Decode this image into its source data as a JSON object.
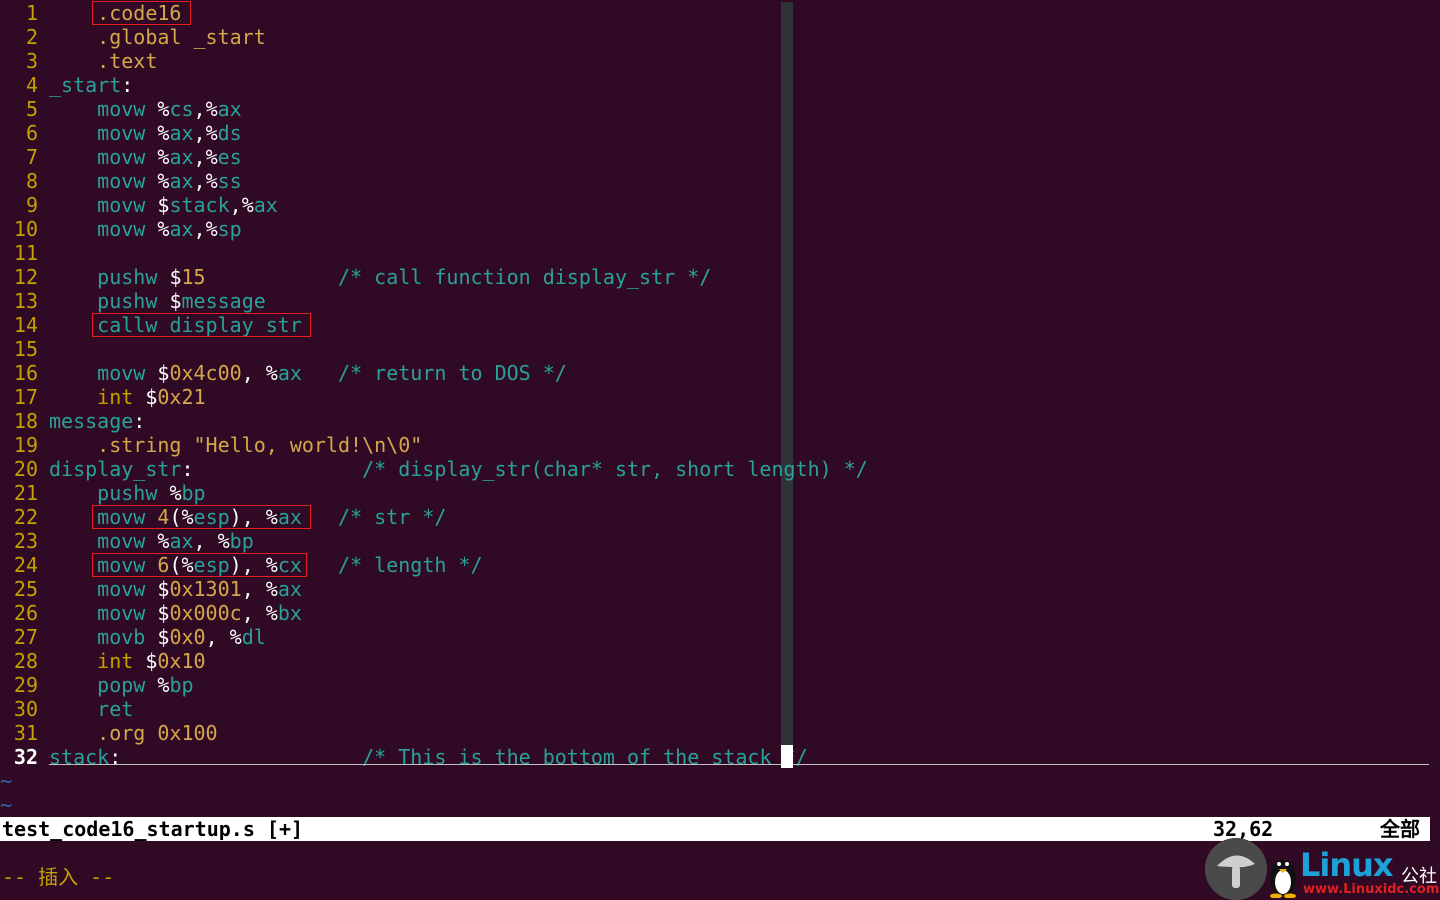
{
  "editor": {
    "lines": [
      {
        "num": "1",
        "tokens": [
          [
            "    ",
            "plain"
          ],
          [
            ".code16",
            "dir"
          ]
        ]
      },
      {
        "num": "2",
        "tokens": [
          [
            "    ",
            "plain"
          ],
          [
            ".global",
            "dir"
          ],
          [
            " ",
            "plain"
          ],
          [
            "_start",
            "dir"
          ]
        ]
      },
      {
        "num": "3",
        "tokens": [
          [
            "    ",
            "plain"
          ],
          [
            ".text",
            "dir"
          ]
        ]
      },
      {
        "num": "4",
        "tokens": [
          [
            "_start",
            "lbl"
          ],
          [
            ":",
            "plain"
          ]
        ]
      },
      {
        "num": "5",
        "tokens": [
          [
            "    ",
            "plain"
          ],
          [
            "movw",
            "inst"
          ],
          [
            " ",
            "plain"
          ],
          [
            "%",
            "pct"
          ],
          [
            "cs",
            "reg"
          ],
          [
            ",",
            "plain"
          ],
          [
            "%",
            "pct"
          ],
          [
            "ax",
            "reg"
          ]
        ]
      },
      {
        "num": "6",
        "tokens": [
          [
            "    ",
            "plain"
          ],
          [
            "movw",
            "inst"
          ],
          [
            " ",
            "plain"
          ],
          [
            "%",
            "pct"
          ],
          [
            "ax",
            "reg"
          ],
          [
            ",",
            "plain"
          ],
          [
            "%",
            "pct"
          ],
          [
            "ds",
            "reg"
          ]
        ]
      },
      {
        "num": "7",
        "tokens": [
          [
            "    ",
            "plain"
          ],
          [
            "movw",
            "inst"
          ],
          [
            " ",
            "plain"
          ],
          [
            "%",
            "pct"
          ],
          [
            "ax",
            "reg"
          ],
          [
            ",",
            "plain"
          ],
          [
            "%",
            "pct"
          ],
          [
            "es",
            "reg"
          ]
        ]
      },
      {
        "num": "8",
        "tokens": [
          [
            "    ",
            "plain"
          ],
          [
            "movw",
            "inst"
          ],
          [
            " ",
            "plain"
          ],
          [
            "%",
            "pct"
          ],
          [
            "ax",
            "reg"
          ],
          [
            ",",
            "plain"
          ],
          [
            "%",
            "pct"
          ],
          [
            "ss",
            "reg"
          ]
        ]
      },
      {
        "num": "9",
        "tokens": [
          [
            "    ",
            "plain"
          ],
          [
            "movw",
            "inst"
          ],
          [
            " ",
            "plain"
          ],
          [
            "$",
            "plain"
          ],
          [
            "stack",
            "reg"
          ],
          [
            ",",
            "plain"
          ],
          [
            "%",
            "pct"
          ],
          [
            "ax",
            "reg"
          ]
        ]
      },
      {
        "num": "10",
        "tokens": [
          [
            "    ",
            "plain"
          ],
          [
            "movw",
            "inst"
          ],
          [
            " ",
            "plain"
          ],
          [
            "%",
            "pct"
          ],
          [
            "ax",
            "reg"
          ],
          [
            ",",
            "plain"
          ],
          [
            "%",
            "pct"
          ],
          [
            "sp",
            "reg"
          ]
        ]
      },
      {
        "num": "11",
        "tokens": []
      },
      {
        "num": "12",
        "tokens": [
          [
            "    ",
            "plain"
          ],
          [
            "pushw",
            "inst"
          ],
          [
            " ",
            "plain"
          ],
          [
            "$",
            "plain"
          ],
          [
            "15",
            "num"
          ],
          [
            "           ",
            "plain"
          ],
          [
            "/* call function display_str */",
            "cmt"
          ]
        ]
      },
      {
        "num": "13",
        "tokens": [
          [
            "    ",
            "plain"
          ],
          [
            "pushw",
            "inst"
          ],
          [
            " ",
            "plain"
          ],
          [
            "$",
            "plain"
          ],
          [
            "message",
            "reg"
          ]
        ]
      },
      {
        "num": "14",
        "tokens": [
          [
            "    ",
            "plain"
          ],
          [
            "callw",
            "inst"
          ],
          [
            " ",
            "plain"
          ],
          [
            "display_str",
            "reg"
          ]
        ]
      },
      {
        "num": "15",
        "tokens": []
      },
      {
        "num": "16",
        "tokens": [
          [
            "    ",
            "plain"
          ],
          [
            "movw",
            "inst"
          ],
          [
            " ",
            "plain"
          ],
          [
            "$",
            "plain"
          ],
          [
            "0x4c00",
            "num"
          ],
          [
            ", ",
            "plain"
          ],
          [
            "%",
            "pct"
          ],
          [
            "ax",
            "reg"
          ],
          [
            "   ",
            "plain"
          ],
          [
            "/* return to DOS */",
            "cmt"
          ]
        ]
      },
      {
        "num": "17",
        "tokens": [
          [
            "    ",
            "plain"
          ],
          [
            "int",
            "kw"
          ],
          [
            " ",
            "plain"
          ],
          [
            "$",
            "plain"
          ],
          [
            "0x21",
            "num"
          ]
        ]
      },
      {
        "num": "18",
        "tokens": [
          [
            "message",
            "lbl"
          ],
          [
            ":",
            "plain"
          ]
        ]
      },
      {
        "num": "19",
        "tokens": [
          [
            "    ",
            "plain"
          ],
          [
            ".string",
            "dir"
          ],
          [
            " ",
            "plain"
          ],
          [
            "\"Hello, world!\\n\\0\"",
            "str"
          ]
        ]
      },
      {
        "num": "20",
        "tokens": [
          [
            "display_str",
            "lbl"
          ],
          [
            ":",
            "plain"
          ],
          [
            "              ",
            "plain"
          ],
          [
            "/* display_str(char* str, short length) */",
            "cmt"
          ]
        ]
      },
      {
        "num": "21",
        "tokens": [
          [
            "    ",
            "plain"
          ],
          [
            "pushw",
            "inst"
          ],
          [
            " ",
            "plain"
          ],
          [
            "%",
            "pct"
          ],
          [
            "bp",
            "reg"
          ]
        ]
      },
      {
        "num": "22",
        "tokens": [
          [
            "    ",
            "plain"
          ],
          [
            "movw",
            "inst"
          ],
          [
            " ",
            "plain"
          ],
          [
            "4",
            "num"
          ],
          [
            "(",
            "plain"
          ],
          [
            "%",
            "pct"
          ],
          [
            "esp",
            "reg"
          ],
          [
            "), ",
            "plain"
          ],
          [
            "%",
            "pct"
          ],
          [
            "ax",
            "reg"
          ],
          [
            "   ",
            "plain"
          ],
          [
            "/* str */",
            "cmt"
          ]
        ]
      },
      {
        "num": "23",
        "tokens": [
          [
            "    ",
            "plain"
          ],
          [
            "movw",
            "inst"
          ],
          [
            " ",
            "plain"
          ],
          [
            "%",
            "pct"
          ],
          [
            "ax",
            "reg"
          ],
          [
            ", ",
            "plain"
          ],
          [
            "%",
            "pct"
          ],
          [
            "bp",
            "reg"
          ]
        ]
      },
      {
        "num": "24",
        "tokens": [
          [
            "    ",
            "plain"
          ],
          [
            "movw",
            "inst"
          ],
          [
            " ",
            "plain"
          ],
          [
            "6",
            "num"
          ],
          [
            "(",
            "plain"
          ],
          [
            "%",
            "pct"
          ],
          [
            "esp",
            "reg"
          ],
          [
            "), ",
            "plain"
          ],
          [
            "%",
            "pct"
          ],
          [
            "cx",
            "reg"
          ],
          [
            "   ",
            "plain"
          ],
          [
            "/* length */",
            "cmt"
          ]
        ]
      },
      {
        "num": "25",
        "tokens": [
          [
            "    ",
            "plain"
          ],
          [
            "movw",
            "inst"
          ],
          [
            " ",
            "plain"
          ],
          [
            "$",
            "plain"
          ],
          [
            "0x1301",
            "num"
          ],
          [
            ", ",
            "plain"
          ],
          [
            "%",
            "pct"
          ],
          [
            "ax",
            "reg"
          ]
        ]
      },
      {
        "num": "26",
        "tokens": [
          [
            "    ",
            "plain"
          ],
          [
            "movw",
            "inst"
          ],
          [
            " ",
            "plain"
          ],
          [
            "$",
            "plain"
          ],
          [
            "0x000c",
            "num"
          ],
          [
            ", ",
            "plain"
          ],
          [
            "%",
            "pct"
          ],
          [
            "bx",
            "reg"
          ]
        ]
      },
      {
        "num": "27",
        "tokens": [
          [
            "    ",
            "plain"
          ],
          [
            "movb",
            "inst"
          ],
          [
            " ",
            "plain"
          ],
          [
            "$",
            "plain"
          ],
          [
            "0x0",
            "num"
          ],
          [
            ", ",
            "plain"
          ],
          [
            "%",
            "pct"
          ],
          [
            "dl",
            "reg"
          ]
        ]
      },
      {
        "num": "28",
        "tokens": [
          [
            "    ",
            "plain"
          ],
          [
            "int",
            "kw"
          ],
          [
            " ",
            "plain"
          ],
          [
            "$",
            "plain"
          ],
          [
            "0x10",
            "num"
          ]
        ]
      },
      {
        "num": "29",
        "tokens": [
          [
            "    ",
            "plain"
          ],
          [
            "popw",
            "inst"
          ],
          [
            " ",
            "plain"
          ],
          [
            "%",
            "pct"
          ],
          [
            "bp",
            "reg"
          ]
        ]
      },
      {
        "num": "30",
        "tokens": [
          [
            "    ",
            "plain"
          ],
          [
            "ret",
            "inst"
          ]
        ]
      },
      {
        "num": "31",
        "tokens": [
          [
            "    ",
            "plain"
          ],
          [
            ".org",
            "dir"
          ],
          [
            " ",
            "plain"
          ],
          [
            "0x100",
            "num"
          ]
        ]
      },
      {
        "num": "32",
        "tokens": [
          [
            "stack",
            "lbl"
          ],
          [
            ":",
            "plain"
          ],
          [
            "                    ",
            "plain"
          ],
          [
            "/* This is the bottom of the stack */",
            "cmt"
          ]
        ]
      }
    ],
    "tilde_glyph": "~",
    "colors": {
      "background": "#300a24",
      "line_number": "#c4a000",
      "highlight_box": "#e02020",
      "tilde": "#3465a4"
    }
  },
  "statusline": {
    "filename": "test_code16_startup.s [+]",
    "position": "32,62",
    "percent": "全部"
  },
  "mode": {
    "text": "-- 插入 --"
  },
  "watermark": {
    "brand": "Linux",
    "brand_suffix": "公社",
    "url": "www.Linuxidc.com"
  }
}
